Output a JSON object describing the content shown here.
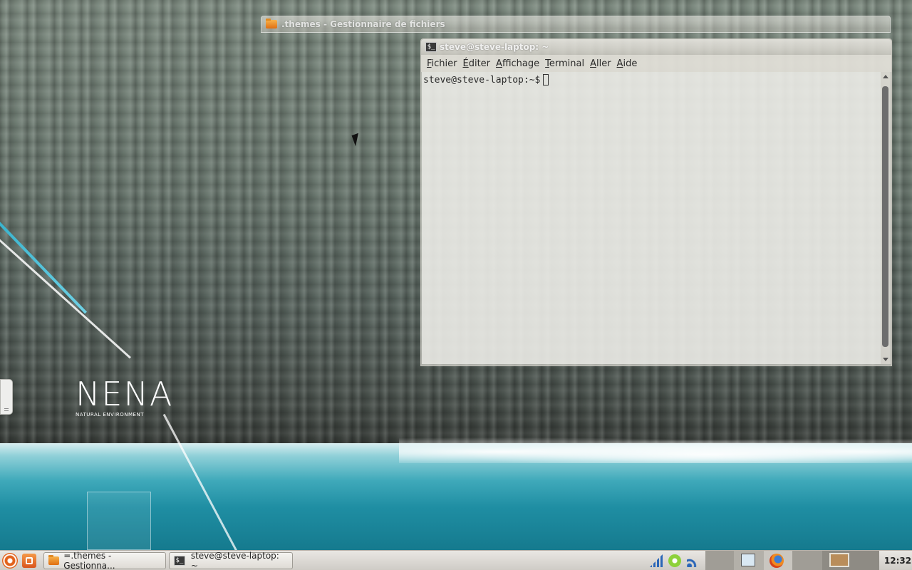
{
  "desktop": {
    "logo_title": "NENA",
    "logo_subtitle": "NATURAL ENVIRONMENT"
  },
  "file_manager_window": {
    "title": ".themes - Gestionnaire de fichiers"
  },
  "terminal_window": {
    "title": "steve@steve-laptop: ~",
    "menu": [
      "Fichier",
      "Éditer",
      "Affichage",
      "Terminal",
      "Aller",
      "Aide"
    ],
    "prompt": "steve@steve-laptop:~$"
  },
  "taskbar": {
    "tasks": [
      {
        "label": "=.themes - Gestionna...",
        "icon": "folder-icon"
      },
      {
        "label": "steve@steve-laptop: ~",
        "icon": "terminal-icon"
      }
    ],
    "clock": "12:32"
  },
  "colors": {
    "accent_orange": "#e2621c",
    "sea_blue": "#1f8ea3"
  }
}
